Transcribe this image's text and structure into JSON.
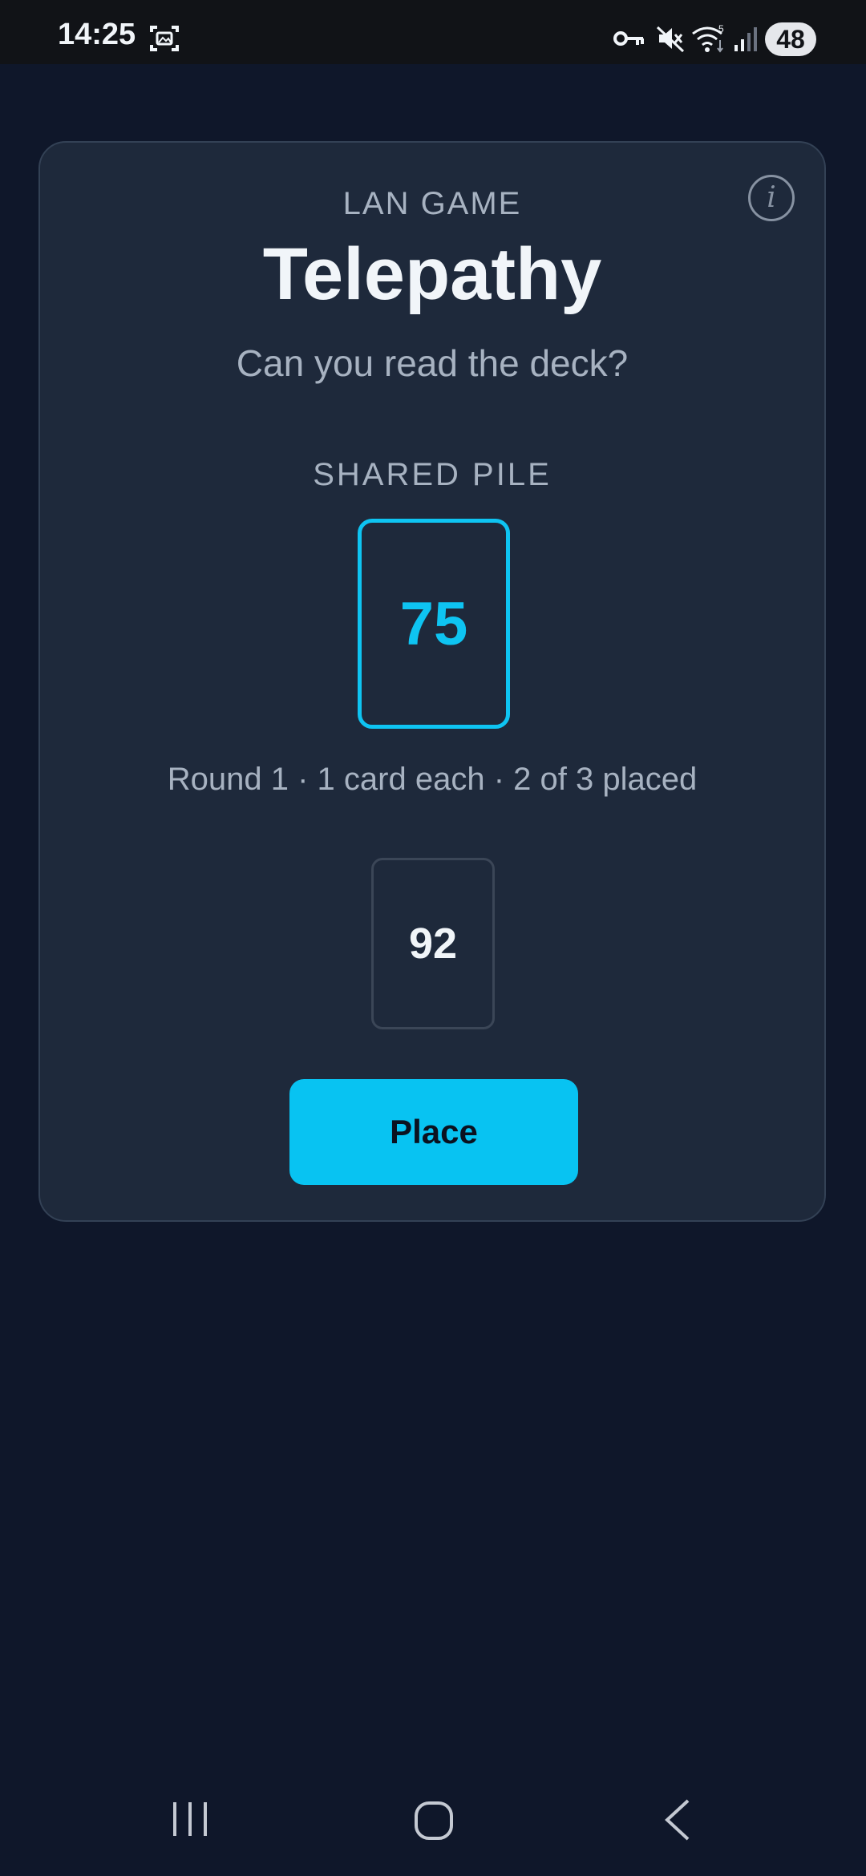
{
  "status_bar": {
    "time": "14:25",
    "battery": "48",
    "icons": [
      "screenshot-icon",
      "key-icon",
      "mute-icon",
      "wifi-icon",
      "signal-icon"
    ]
  },
  "game": {
    "eyebrow": "LAN GAME",
    "title": "Telepathy",
    "subtitle": "Can you read the deck?",
    "pile_label": "SHARED PILE",
    "pile_card": "75",
    "round_status": "Round 1 · 1 card each · 2 of 3 placed",
    "hand_card": "92",
    "place_label": "Place",
    "info_label": "i"
  },
  "nav_bar": {
    "icons": [
      "recent-apps-icon",
      "home-icon",
      "back-icon"
    ]
  },
  "colors": {
    "background": "#0f172a",
    "card": "#1e293b",
    "accent": "#0ec4f2",
    "muted_text": "#a7b2c1"
  }
}
